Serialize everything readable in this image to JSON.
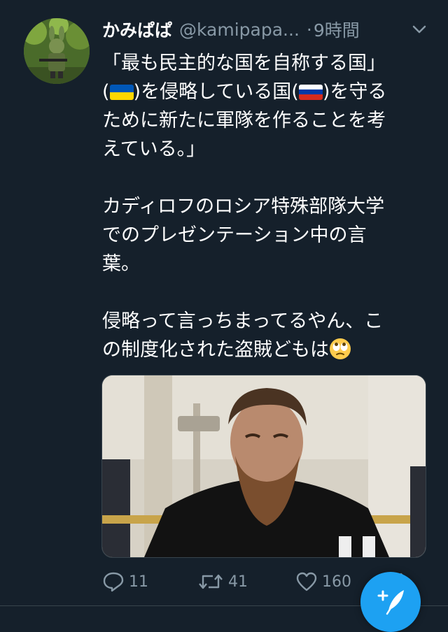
{
  "tweet": {
    "display_name": "かみぱぱ",
    "handle": "@kamipapa...",
    "separator": "·",
    "time": "9時間",
    "body": {
      "line1": "「最も民主的な国を自称する国」",
      "line2a": "(",
      "line2b": ")を侵略している国(",
      "line2c": ")を守る",
      "line3": "ために新たに軍隊を作ることを考",
      "line4": "えている。」",
      "line5": "カディロフのロシア特殊部隊大学",
      "line6": "でのプレゼンテーション中の言",
      "line7": "葉。",
      "line8": "侵略って言っちまってるやん、こ",
      "line9": "の制度化された盗賊どもは"
    },
    "flags": [
      "ukraine-flag",
      "russia-flag"
    ],
    "emoji": "face-with-rolling-eyes",
    "actions": {
      "reply_count": "11",
      "retweet_count": "41",
      "like_count": "160"
    }
  },
  "colors": {
    "background": "#15202b",
    "text": "#ffffff",
    "secondary_text": "#8899a6",
    "accent": "#1da1f2",
    "divider": "#38444d"
  }
}
